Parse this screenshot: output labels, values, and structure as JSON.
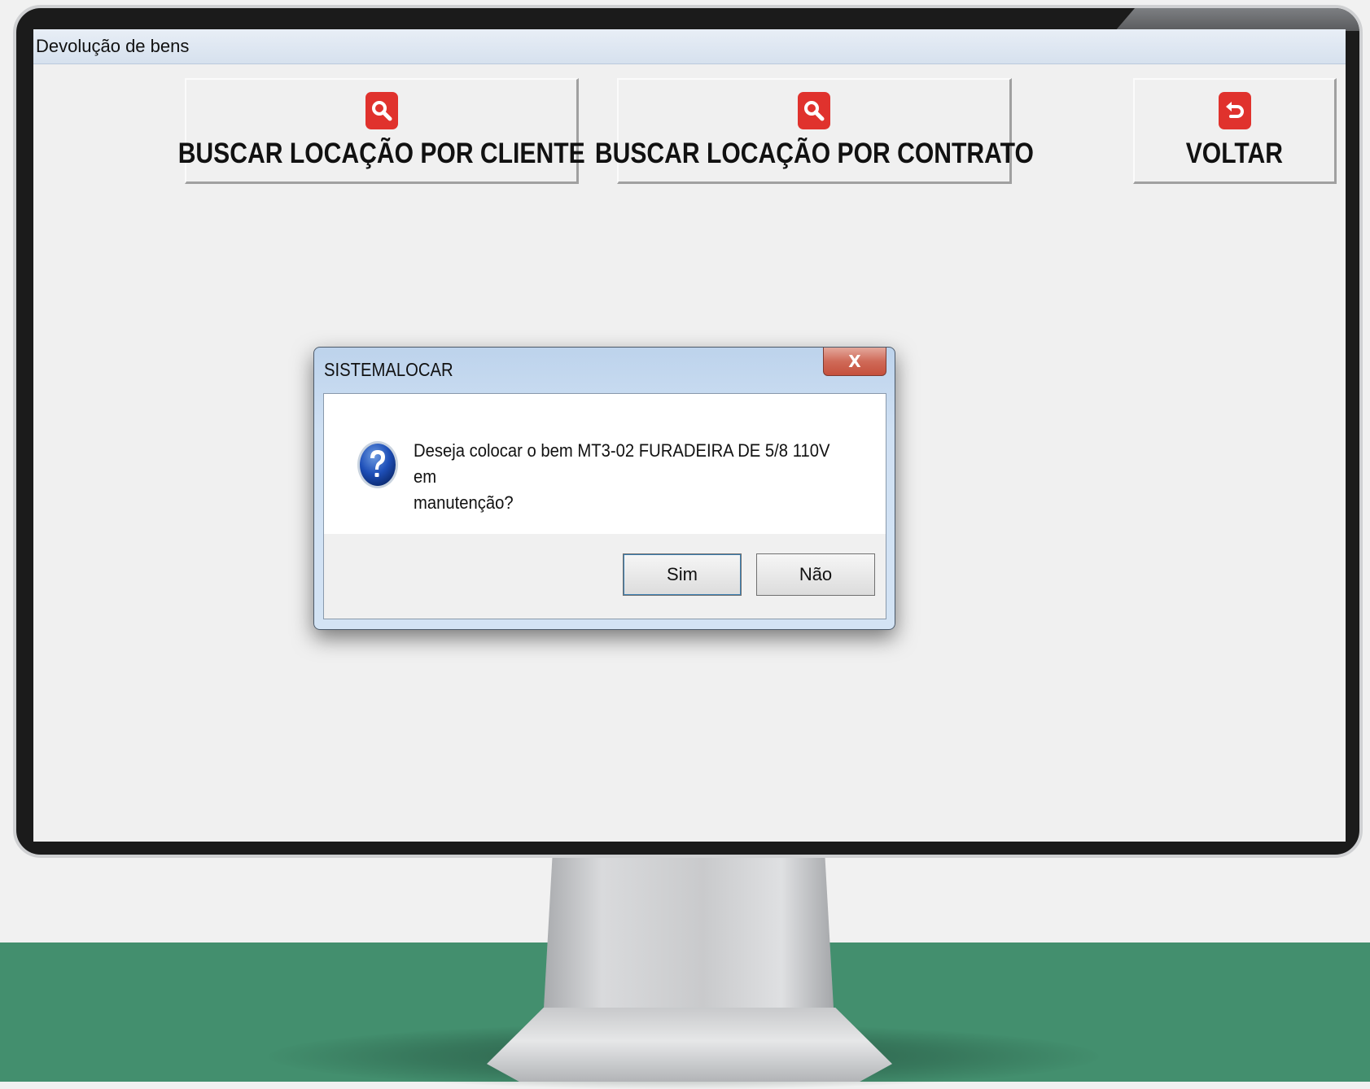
{
  "window": {
    "title": "Devolução de bens"
  },
  "toolbar": {
    "search_by_client_label": "BUSCAR LOCAÇÃO POR CLIENTE",
    "search_by_contract_label": "BUSCAR LOCAÇÃO POR CONTRATO",
    "back_label": "VOLTAR"
  },
  "dialog": {
    "title": "SISTEMALOCAR",
    "close_glyph": "X",
    "message_line1": "Deseja colocar o bem MT3-02 FURADEIRA DE 5/8 110V em",
    "message_line2": "manutenção?",
    "yes_label": "Sim",
    "no_label": "Não"
  },
  "icons": {
    "search": "search-icon",
    "back": "back-arrow-icon",
    "question": "question-icon",
    "close": "close-icon"
  },
  "colors": {
    "accent_red": "#e0322d",
    "floor_green": "#438f6e"
  }
}
